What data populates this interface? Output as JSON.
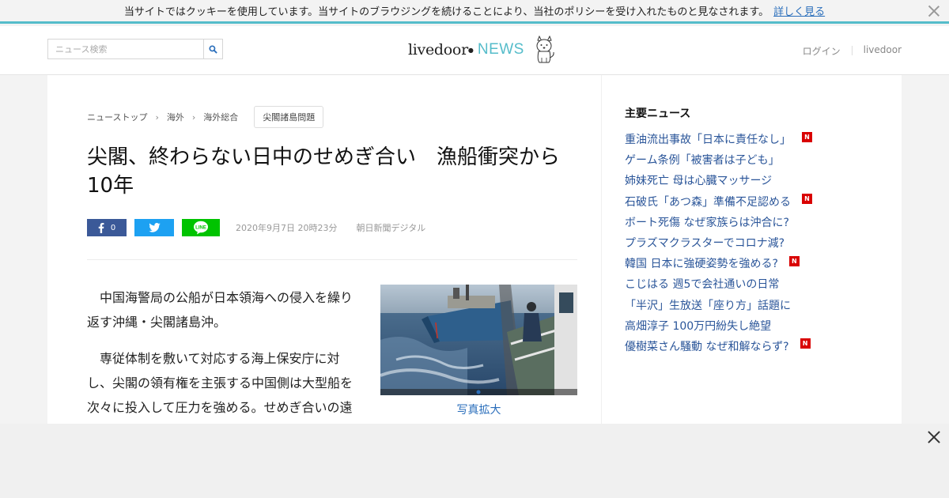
{
  "cookie": {
    "message": "当サイトではクッキーを使用しています。当サイトのブラウジングを続けることにより、当社のポリシーを受け入れたものと見なされます。",
    "link": "詳しく見る"
  },
  "header": {
    "search_placeholder": "ニュース検索",
    "logo_livedoor": "livedoor",
    "logo_news": "NEWS",
    "login": "ログイン",
    "livedoor_link": "livedoor"
  },
  "breadcrumb": {
    "items": [
      "ニューストップ",
      "海外",
      "海外総合"
    ],
    "tag": "尖閣諸島問題"
  },
  "article": {
    "title": "尖閣、終わらない日中のせめぎ合い　漁船衝突から10年",
    "fb_count": "0",
    "date": "2020年9月7日 20時23分",
    "source": "朝日新聞デジタル",
    "paragraphs": [
      "中国海警局の公船が日本領海への侵入を繰り返す沖縄・尖閣諸島沖。",
      "専従体制を敷いて対応する海上保安庁に対し、尖閣の領有権を主張する中国側は大型船を次々に投入して圧力を強める。せめぎ合いの遠"
    ],
    "photo_caption": "写真拡大"
  },
  "sidebar": {
    "title": "主要ニュース",
    "news": [
      {
        "text": "重油流出事故「日本に責任なし」",
        "new": true
      },
      {
        "text": "ゲーム条例「被害者は子ども」",
        "new": false
      },
      {
        "text": "姉妹死亡 母は心臓マッサージ",
        "new": false
      },
      {
        "text": "石破氏「あつ森」準備不足認める",
        "new": true
      },
      {
        "text": "ボート死傷 なぜ家族らは沖合に?",
        "new": false
      },
      {
        "text": "プラズマクラスターでコロナ減?",
        "new": false
      },
      {
        "text": "韓国 日本に強硬姿勢を強める?",
        "new": true
      },
      {
        "text": "こじはる 週5で会社通いの日常",
        "new": false
      },
      {
        "text": "「半沢」生放送「座り方」話題に",
        "new": false
      },
      {
        "text": "高畑淳子 100万円紛失し絶望",
        "new": false
      },
      {
        "text": "優樹菜さん騒動 なぜ和解ならず?",
        "new": true
      }
    ],
    "badge_label": "N"
  },
  "colors": {
    "accent": "#55bcca",
    "link": "#2a5599",
    "facebook": "#3b5998",
    "twitter": "#1da1f2",
    "line": "#00c300",
    "new_badge": "#d90000"
  }
}
